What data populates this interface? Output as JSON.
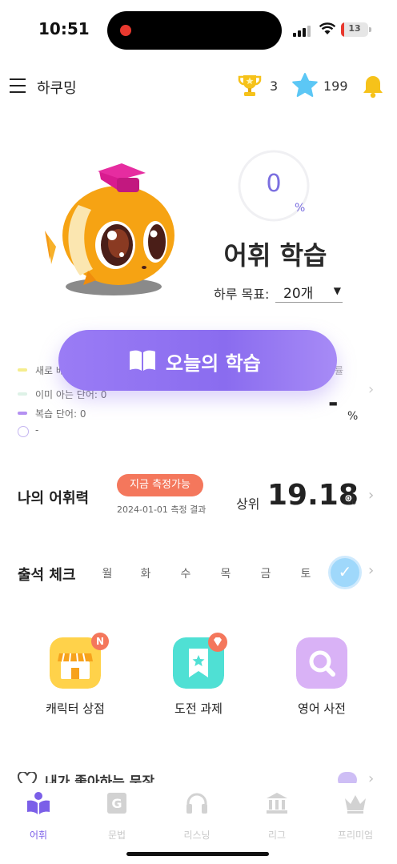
{
  "status_bar": {
    "time": "10:51",
    "battery": "13"
  },
  "header": {
    "title": "하쿠밍",
    "trophy_count": "3",
    "star_count": "199"
  },
  "hero": {
    "progress_value": "0",
    "progress_unit": "%",
    "title": "어휘 학습",
    "goal_label": "하루 목표:",
    "goal_value": "20개"
  },
  "stats": {
    "new_words": "새로 배",
    "known_words": "이미 아는 단어: 0",
    "review_words": "복습 단어: 0",
    "time": "-",
    "rate": "-",
    "rate_unit": "%",
    "partial_right": "률"
  },
  "study_button": {
    "label": "오늘의 학습"
  },
  "vocab_level": {
    "title": "나의 어휘력",
    "badge": "지금 측정가능",
    "date": "2024-01-01 측정 결과",
    "rank_label": "상위",
    "rank_value": "19.18",
    "rank_unit": "%"
  },
  "attendance": {
    "title": "출석 체크",
    "days": [
      "월",
      "화",
      "수",
      "목",
      "금",
      "토"
    ],
    "check": "✓"
  },
  "tiles": [
    {
      "label": "캐릭터 상점",
      "badge": "N"
    },
    {
      "label": "도전 과제"
    },
    {
      "label": "영어 사전"
    }
  ],
  "liked_sentences": {
    "title": "내가 좋아하는 문장"
  },
  "bottom_nav": [
    {
      "label": "어휘",
      "active": true
    },
    {
      "label": "문법"
    },
    {
      "label": "리스닝"
    },
    {
      "label": "리그"
    },
    {
      "label": "프리미엄"
    }
  ],
  "colors": {
    "accent": "#8a6cef",
    "badge": "#f4775c",
    "inactive": "#c9c9c9"
  }
}
